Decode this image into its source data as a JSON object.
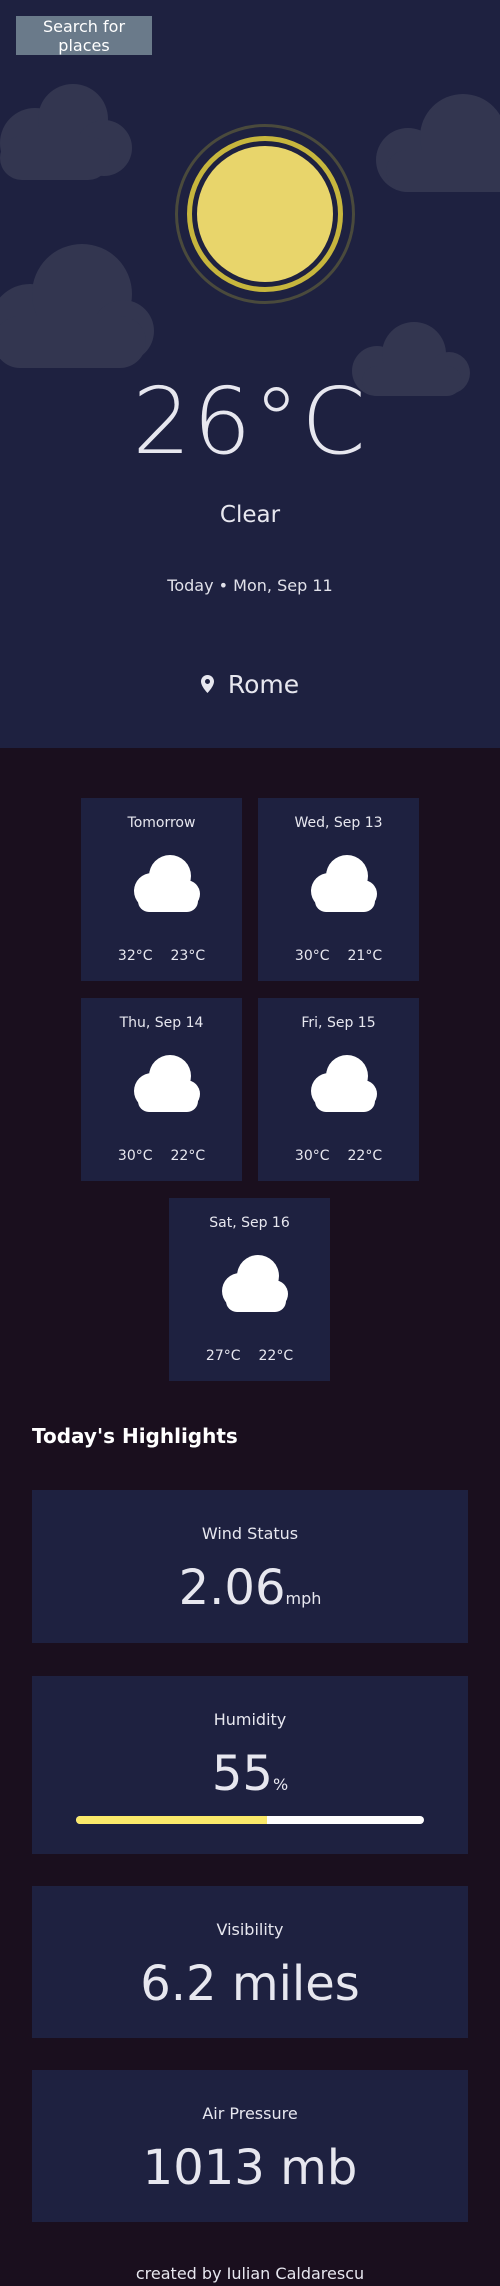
{
  "search": {
    "label": "Search for places"
  },
  "current": {
    "temperature": "26°C",
    "condition": "Clear",
    "date": "Today • Mon, Sep 11",
    "location": "Rome",
    "icon": "sun-icon"
  },
  "forecast": [
    {
      "day": "Tomorrow",
      "max": "32°C",
      "min": "23°C",
      "icon": "cloud-icon"
    },
    {
      "day": "Wed, Sep 13",
      "max": "30°C",
      "min": "21°C",
      "icon": "cloud-icon"
    },
    {
      "day": "Thu, Sep 14",
      "max": "30°C",
      "min": "22°C",
      "icon": "cloud-icon"
    },
    {
      "day": "Fri, Sep 15",
      "max": "30°C",
      "min": "22°C",
      "icon": "cloud-icon"
    },
    {
      "day": "Sat, Sep 16",
      "max": "27°C",
      "min": "22°C",
      "icon": "cloud-icon"
    }
  ],
  "highlights": {
    "title": "Today's Highlights",
    "wind": {
      "label": "Wind Status",
      "value": "2.06",
      "unit": "mph"
    },
    "humidity": {
      "label": "Humidity",
      "value": "55",
      "unit": "%",
      "level": 0.55
    },
    "visibility": {
      "label": "Visibility",
      "value": "6.2 miles"
    },
    "pressure": {
      "label": "Air Pressure",
      "value": "1013 mb"
    }
  },
  "footer": {
    "text": "created by Iulian Caldarescu"
  },
  "colors": {
    "panel": "#1e2140",
    "background": "#1a0f1e",
    "sun": "#e8d56b",
    "humidity_fill": "#fbe96a",
    "search_button": "#6a7a8a"
  }
}
